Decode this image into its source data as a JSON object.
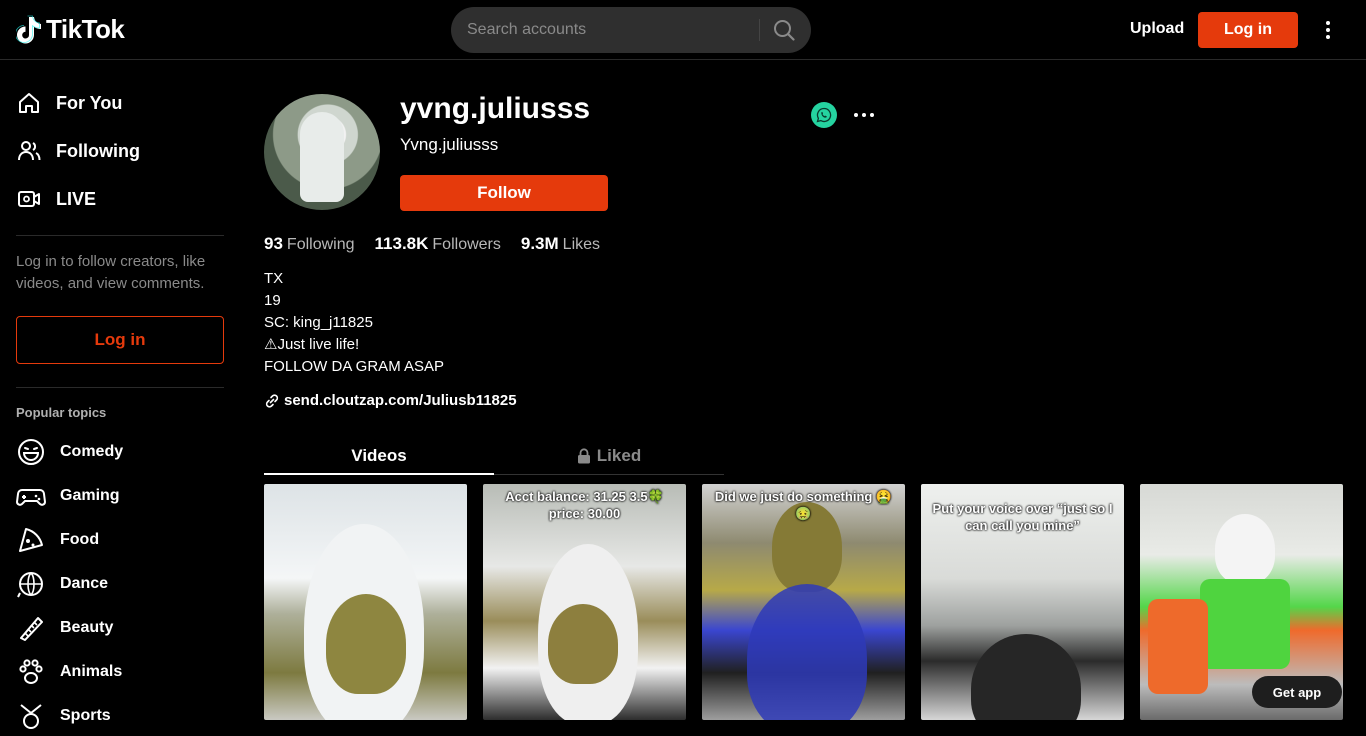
{
  "header": {
    "logo_text": "TikTok",
    "search_placeholder": "Search accounts",
    "upload_label": "Upload",
    "login_label": "Log in"
  },
  "sidebar": {
    "nav": [
      {
        "label": "For You",
        "icon": "home-icon"
      },
      {
        "label": "Following",
        "icon": "users-icon"
      },
      {
        "label": "LIVE",
        "icon": "live-icon"
      }
    ],
    "login_hint": "Log in to follow creators, like videos, and view comments.",
    "login_label": "Log in",
    "topics_title": "Popular topics",
    "topics": [
      {
        "label": "Comedy",
        "icon": "comedy-icon"
      },
      {
        "label": "Gaming",
        "icon": "gaming-icon"
      },
      {
        "label": "Food",
        "icon": "food-icon"
      },
      {
        "label": "Dance",
        "icon": "dance-icon"
      },
      {
        "label": "Beauty",
        "icon": "beauty-icon"
      },
      {
        "label": "Animals",
        "icon": "animals-icon"
      },
      {
        "label": "Sports",
        "icon": "sports-icon"
      }
    ]
  },
  "profile": {
    "username": "yvng.juliusss",
    "nickname": "Yvng.juliusss",
    "follow_label": "Follow",
    "stats": [
      {
        "value": "93",
        "label": "Following"
      },
      {
        "value": "113.8K",
        "label": "Followers"
      },
      {
        "value": "9.3M",
        "label": "Likes"
      }
    ],
    "bio": [
      "TX",
      "19",
      "SC: king_j11825",
      "⚠Just live life!",
      "FOLLOW DA GRAM ASAP"
    ],
    "link": "send.cloutzap.com/Juliusb11825"
  },
  "tabs": [
    {
      "label": "Videos"
    },
    {
      "label": "Liked"
    }
  ],
  "videos": [
    {
      "caption": ""
    },
    {
      "caption": "Acct balance: 31.25 3.5🍀price: 30.00"
    },
    {
      "caption": "Did we just do something 🤮🤢"
    },
    {
      "caption": "Put your voice over “just so I can call you mine”"
    },
    {
      "caption": ""
    }
  ],
  "get_app_label": "Get app",
  "colors": {
    "accent": "#e53a0c",
    "background": "#000000",
    "share": "#25d3a0"
  }
}
